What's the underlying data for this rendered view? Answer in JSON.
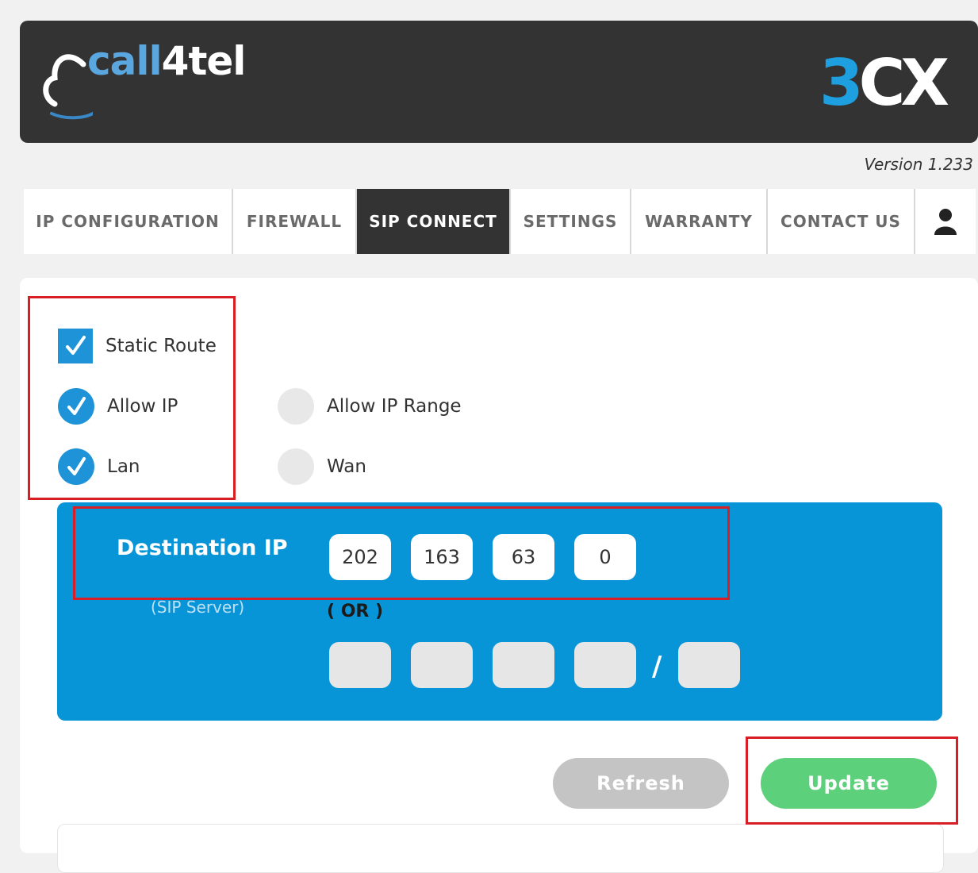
{
  "brand": {
    "logo_left": "call4tel",
    "logo_right": "3CX"
  },
  "version": "Version 1.233",
  "tabs": [
    {
      "label": "IP CONFIGURATION",
      "active": false
    },
    {
      "label": "FIREWALL",
      "active": false
    },
    {
      "label": "SIP CONNECT",
      "active": true
    },
    {
      "label": "SETTINGS",
      "active": false
    },
    {
      "label": "WARRANTY",
      "active": false
    },
    {
      "label": "CONTACT US",
      "active": false
    }
  ],
  "user_icon": "user-icon",
  "options": {
    "static_route": {
      "label": "Static Route",
      "checked": true
    },
    "allow_ip": {
      "label": "Allow IP",
      "checked": true
    },
    "allow_ip_range": {
      "label": "Allow IP Range",
      "checked": false
    },
    "lan": {
      "label": "Lan",
      "checked": true
    },
    "wan": {
      "label": "Wan",
      "checked": false
    }
  },
  "destination": {
    "title": "Destination IP",
    "subtitle": "(SIP Server)",
    "ip": [
      "202",
      "163",
      "63",
      "0"
    ],
    "or_label": "( OR )",
    "range": [
      "",
      "",
      "",
      ""
    ],
    "slash": "/",
    "mask": ""
  },
  "buttons": {
    "refresh": "Refresh",
    "update": "Update"
  },
  "colors": {
    "header": "#333333",
    "accent": "#0795d8",
    "update": "#5dd07b",
    "refresh": "#c4c4c4",
    "highlight": "#d81f26"
  }
}
